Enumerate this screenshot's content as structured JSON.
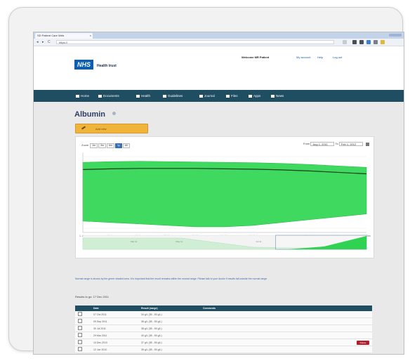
{
  "browser": {
    "tab_title": "SD Patient Care Web",
    "tab_close": "×",
    "url": "https://",
    "back": "◂",
    "forward": "▸",
    "reload": "C"
  },
  "header": {
    "logo_text": "NHS",
    "trust_name": "Health trust",
    "welcome": "Welcome MR Patient",
    "links": [
      "My account",
      "Help",
      "Log out"
    ]
  },
  "nav": {
    "items": [
      "Home",
      "Documents",
      "Health",
      "Guidelines",
      "Journal",
      "Files",
      "Apps",
      "News"
    ]
  },
  "page": {
    "title": "Albumin",
    "add_button": "Add new"
  },
  "chart": {
    "zoom_label": "Zoom",
    "zoom_options": [
      "1m",
      "3m",
      "6m",
      "1y",
      "All"
    ],
    "zoom_active": 3,
    "from_label": "From",
    "from_value": "Aug 1, 2011",
    "to_label": "To",
    "to_value": "Feb 1, 2012",
    "x_ticks": [
      "1. Aug",
      "15. Aug",
      "29. Aug",
      "12. Sep",
      "26. Sep",
      "10. Oct",
      "24. Oct",
      "7. Nov",
      "21. Nov",
      "5. Dec",
      "19. Dec"
    ],
    "nav_labels": [
      "Mar 11",
      "May 11",
      "Jul 11"
    ],
    "colors": {
      "band": "#3fd95f",
      "band_edge": "#2bbd49",
      "line": "#1e3a1e",
      "navigator": "#cfeed4",
      "nav_selected": "#2fd251"
    }
  },
  "chart_data": {
    "type": "area",
    "title": "",
    "xlabel": "",
    "ylabel": "",
    "x": [
      "1. Aug",
      "15. Aug",
      "29. Aug",
      "12. Sep",
      "26. Sep",
      "10. Oct",
      "24. Oct",
      "7. Nov",
      "21. Nov",
      "5. Dec",
      "19. Dec"
    ],
    "series": [
      {
        "values": [
          0.92,
          0.93,
          0.935,
          0.93,
          0.925,
          0.92,
          0.915,
          0.905,
          0.89,
          0.87,
          0.85
        ]
      },
      {
        "values": [
          0.1,
          0.08,
          0.06,
          0.04,
          0.02,
          0.02,
          0.04,
          0.08,
          0.12,
          0.16,
          0.2
        ]
      },
      {
        "values": [
          0.82,
          0.83,
          0.835,
          0.835,
          0.835,
          0.83,
          0.825,
          0.815,
          0.8,
          0.78,
          0.76
        ]
      }
    ]
  },
  "caption": "Normal range is shown by the green shaded area. It is important that the result remains within the normal range. Please talk to your doctor if results fall outside the normal range.",
  "table": {
    "subhead": "Results to go: 17 Dec 2011",
    "headers": [
      "",
      "Date",
      "Result (range)",
      "Comments"
    ],
    "rows": [
      {
        "date": "07 Oct 2011",
        "range": "34 g/L (35 - 50 g/L)",
        "comment": ""
      },
      {
        "date": "09 Sep 2011",
        "range": "36 g/L (35 - 50 g/L)",
        "comment": ""
      },
      {
        "date": "30 Jul 2011",
        "range": "38 g/L (35 - 50 g/L)",
        "comment": ""
      },
      {
        "date": "29 Mar 2011",
        "range": "40 g/L (35 - 50 g/L)",
        "comment": ""
      },
      {
        "date": "10 Dec 2010",
        "range": "37 g/L (35 - 50 g/L)",
        "comment": ""
      },
      {
        "date": "12 Jun 2010",
        "range": "35 g/L (35 - 50 g/L)",
        "comment": ""
      }
    ],
    "delete_label": "Delete"
  }
}
